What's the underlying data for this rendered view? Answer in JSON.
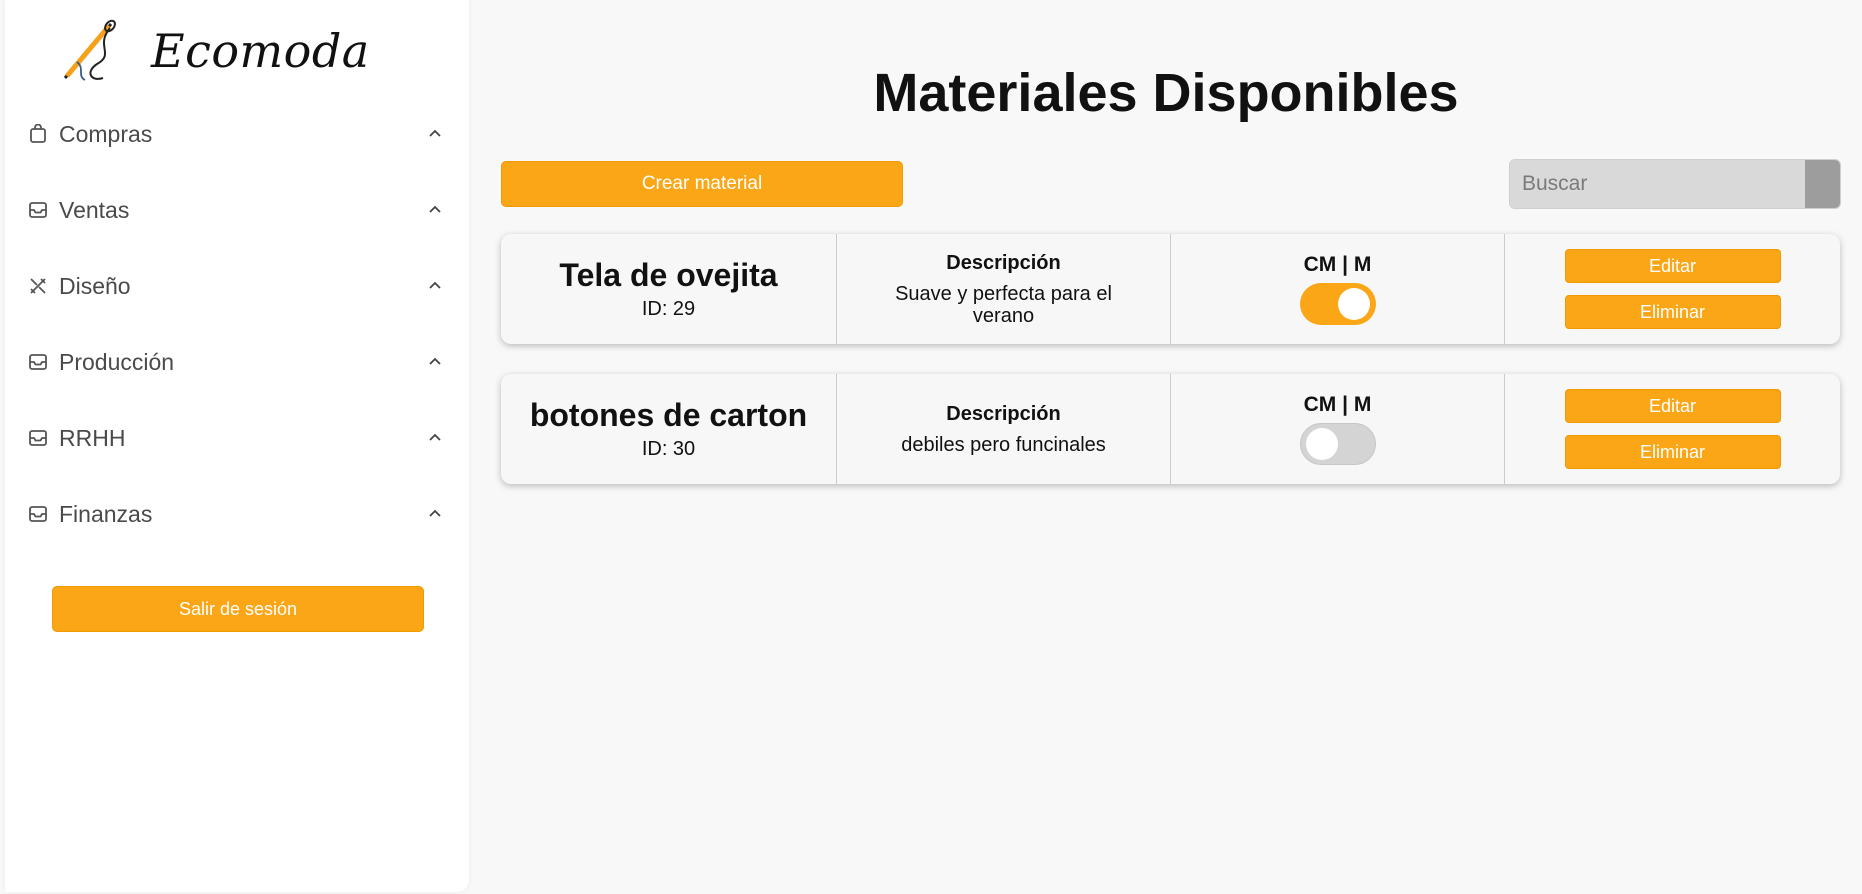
{
  "brand": {
    "name": "Ecomoda",
    "logo_icon": "needle-thread-icon"
  },
  "sidebar": {
    "items": [
      {
        "label": "Compras",
        "icon": "shopping-bag-icon"
      },
      {
        "label": "Ventas",
        "icon": "inbox-icon"
      },
      {
        "label": "Diseño",
        "icon": "design-tools-icon"
      },
      {
        "label": "Producción",
        "icon": "inbox-icon"
      },
      {
        "label": "RRHH",
        "icon": "inbox-icon"
      },
      {
        "label": "Finanzas",
        "icon": "inbox-icon"
      }
    ],
    "logout_label": "Salir de sesión"
  },
  "main": {
    "title": "Materiales Disponibles",
    "create_label": "Crear material",
    "search": {
      "placeholder": "Buscar",
      "value": ""
    },
    "materials": [
      {
        "name": "Tela de ovejita",
        "id_text": "ID: 29",
        "desc_title": "Descripción",
        "description": "Suave y perfecta para el verano",
        "unit_label": "CM | M",
        "unit_toggle_on": true,
        "edit_label": "Editar",
        "delete_label": "Eliminar"
      },
      {
        "name": "botones de carton",
        "id_text": "ID: 30",
        "desc_title": "Descripción",
        "description": "debiles pero funcinales",
        "unit_label": "CM | M",
        "unit_toggle_on": false,
        "edit_label": "Editar",
        "delete_label": "Eliminar"
      }
    ]
  },
  "colors": {
    "accent": "#fba616",
    "background": "#f8f8f8",
    "toggle_off": "#d4d4d4",
    "search_button": "#9d9d9d"
  }
}
